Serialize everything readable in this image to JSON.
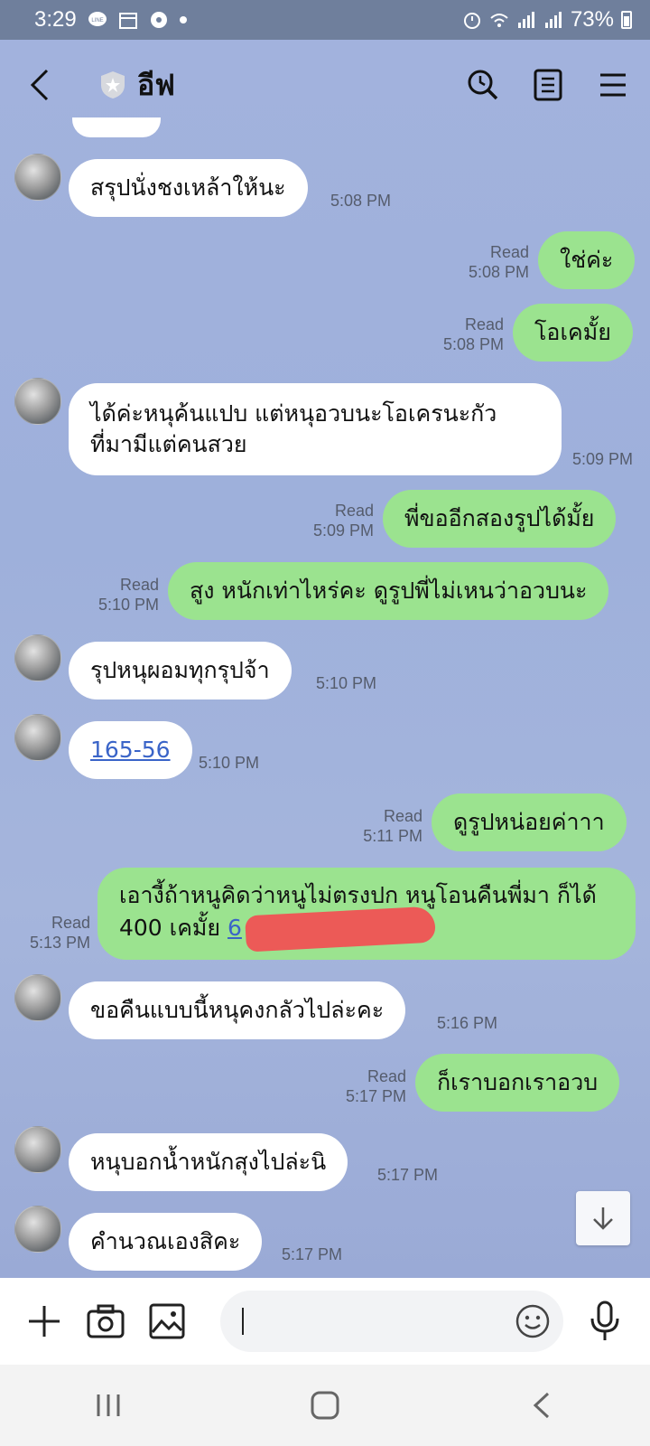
{
  "status_bar": {
    "time": "3:29",
    "battery": "73%",
    "icons": [
      "line-icon",
      "calendar-icon",
      "soccer-icon",
      "dot-icon",
      "alarm-icon",
      "wifi-icon",
      "signal-icon",
      "signal-icon",
      "battery-icon"
    ]
  },
  "header": {
    "title": "อีฟ",
    "icons": [
      "back-icon",
      "shield-icon",
      "search-icon",
      "notes-icon",
      "menu-icon"
    ]
  },
  "messages": [
    {
      "side": "in",
      "text": "สรุปนั่งชงเหล้าให้นะ",
      "time": "5:08 PM"
    },
    {
      "side": "out",
      "text": "ใช่ค่ะ",
      "read": "Read",
      "time": "5:08 PM"
    },
    {
      "side": "out",
      "text": "โอเคมั้ย",
      "read": "Read",
      "time": "5:08 PM"
    },
    {
      "side": "in",
      "text": "ได้ค่ะหนุค้นแปบ แต่หนุอวบนะโอเครนะกัว ที่มามีแต่คนสวย",
      "time": "5:09 PM"
    },
    {
      "side": "out",
      "text": "พี่ขออีกสองรูปได้มั้ย",
      "read": "Read",
      "time": "5:09 PM"
    },
    {
      "side": "out",
      "text": "สูง หนักเท่าไหร่คะ ดูรูปพี่ไม่เหนว่าอวบนะ",
      "read": "Read",
      "time": "5:10 PM"
    },
    {
      "side": "in",
      "text": "รุปหนุผอมทุกรุปจ้า",
      "time": "5:10 PM"
    },
    {
      "side": "in",
      "text": "165-56",
      "time": "5:10 PM",
      "is_link": true
    },
    {
      "side": "out",
      "text": "ดูรูปหน่อยค่าาา",
      "read": "Read",
      "time": "5:11 PM"
    },
    {
      "side": "out",
      "text": "เอางี้ถ้าหนูคิดว่าหนูไม่ตรงปก หนูโอนคืนพี่มา ก็ได้ 400 เคมั้ย",
      "link_text": "6",
      "read": "Read",
      "time": "5:13 PM"
    },
    {
      "side": "in",
      "text": "ขอคืนแบบนี้หนุคงกลัวไปล่ะคะ",
      "time": "5:16 PM"
    },
    {
      "side": "out",
      "text": "ก็เราบอกเราอวบ",
      "read": "Read",
      "time": "5:17 PM"
    },
    {
      "side": "in",
      "text": "หนุบอกน้ำหนักสุงไปล่ะนิ",
      "time": "5:17 PM"
    },
    {
      "side": "in",
      "text": "คำนวณเองสิคะ",
      "time": "5:17 PM"
    }
  ],
  "input_bar": {
    "icons": [
      "plus-icon",
      "camera-icon",
      "image-icon",
      "emoji-icon",
      "mic-icon"
    ],
    "placeholder": ""
  },
  "nav_bar": {
    "icons": [
      "recent-apps-icon",
      "home-icon",
      "back-nav-icon"
    ]
  },
  "colors": {
    "outgoing_bubble": "#9be38f",
    "incoming_bubble": "#ffffff",
    "chat_background": "#a0b1db",
    "redaction": "#ec5a57"
  }
}
